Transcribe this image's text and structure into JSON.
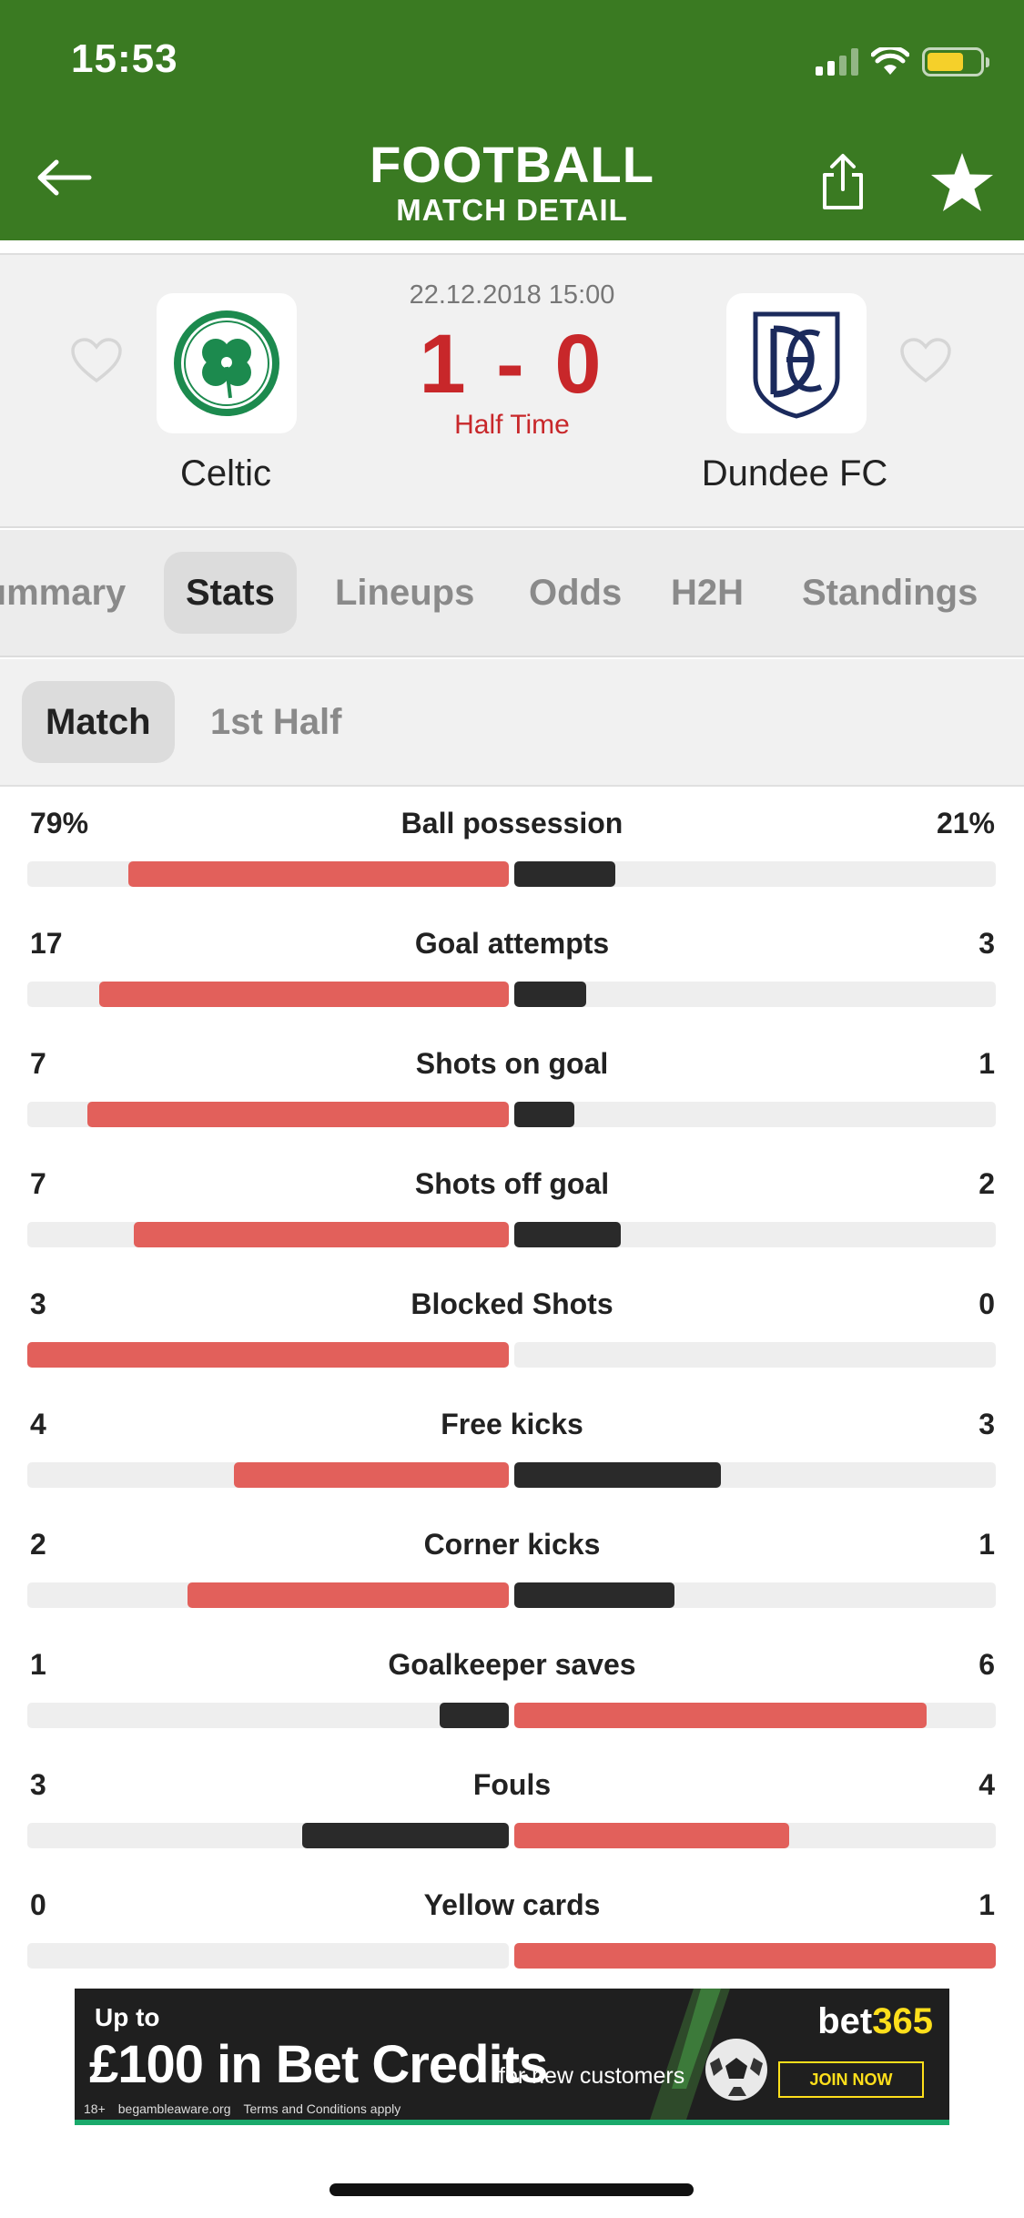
{
  "status_bar": {
    "time": "15:53"
  },
  "header": {
    "title": "FOOTBALL",
    "subtitle": "MATCH DETAIL"
  },
  "match": {
    "datetime": "22.12.2018 15:00",
    "score": "1 - 0",
    "status": "Half Time",
    "home_team": "Celtic",
    "away_team": "Dundee FC"
  },
  "tabs": [
    "ımmary",
    "Stats",
    "Lineups",
    "Odds",
    "H2H",
    "Standings"
  ],
  "active_tab": "Stats",
  "subtabs": [
    "Match",
    "1st Half"
  ],
  "active_subtab": "Match",
  "colors": {
    "header_green": "#3a7a22",
    "score_red": "#c8272a",
    "bar_leading": "#e2605b",
    "bar_trailing": "#2a2a2a"
  },
  "stats": [
    {
      "label": "Ball possession",
      "home": "79%",
      "away": "21%",
      "home_share": 0.79,
      "away_share": 0.21
    },
    {
      "label": "Goal attempts",
      "home": "17",
      "away": "3",
      "home_share": 0.85,
      "away_share": 0.15
    },
    {
      "label": "Shots on goal",
      "home": "7",
      "away": "1",
      "home_share": 0.875,
      "away_share": 0.125
    },
    {
      "label": "Shots off goal",
      "home": "7",
      "away": "2",
      "home_share": 0.778,
      "away_share": 0.222
    },
    {
      "label": "Blocked Shots",
      "home": "3",
      "away": "0",
      "home_share": 1.0,
      "away_share": 0.0
    },
    {
      "label": "Free kicks",
      "home": "4",
      "away": "3",
      "home_share": 0.571,
      "away_share": 0.429
    },
    {
      "label": "Corner kicks",
      "home": "2",
      "away": "1",
      "home_share": 0.667,
      "away_share": 0.333
    },
    {
      "label": "Goalkeeper saves",
      "home": "1",
      "away": "6",
      "home_share": 0.143,
      "away_share": 0.857
    },
    {
      "label": "Fouls",
      "home": "3",
      "away": "4",
      "home_share": 0.429,
      "away_share": 0.571
    },
    {
      "label": "Yellow cards",
      "home": "0",
      "away": "1",
      "home_share": 0.0,
      "away_share": 1.0
    }
  ],
  "ad": {
    "line1": "Up to",
    "headline": "£100 in Bet Credits",
    "tagline": "for new customers",
    "brand_main": "bet",
    "brand_accent": "365",
    "cta": "JOIN NOW",
    "fine_age": "18+",
    "fine_site": "begambleaware.org",
    "fine_terms": "Terms and Conditions apply"
  }
}
